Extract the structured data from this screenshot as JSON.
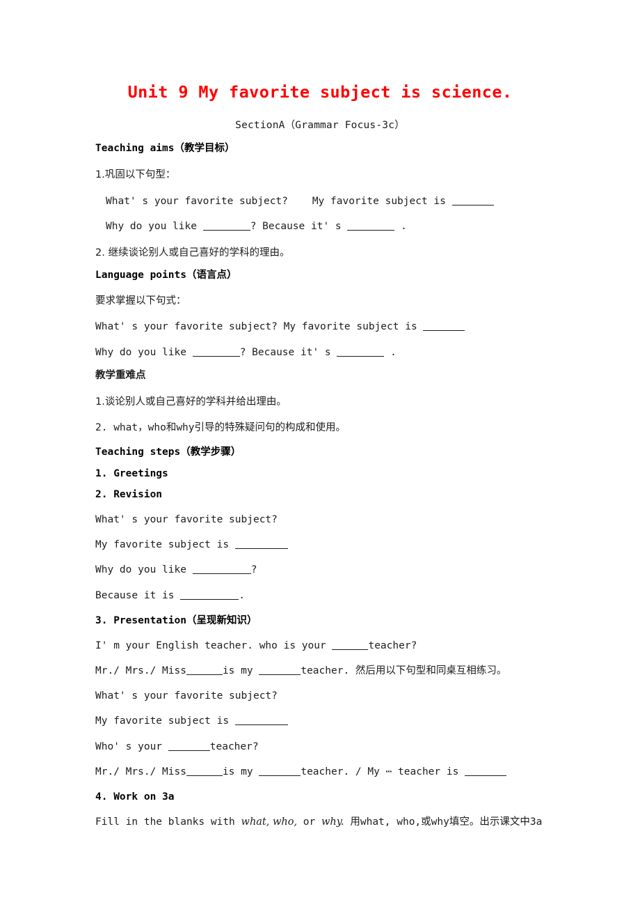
{
  "document": {
    "title": "Unit 9 My favorite subject is science.",
    "subtitle": "SectionA（Grammar Focus-3c）",
    "title_color": "#ff0000"
  },
  "sections": {
    "teaching_aims": {
      "heading": "Teaching aims（教学目标）",
      "item1": "1.巩固以下句型：",
      "q1_a": "What' s your favorite subject?",
      "q1_b": "My favorite subject is",
      "q2_a": "Why do you like",
      "q2_b": "?   Because it' s",
      "q2_c": ".",
      "item2": "2. 继续谈论别人或自己喜好的学科的理由。"
    },
    "language_points": {
      "heading": "Language points（语言点）",
      "intro": "要求掌握以下句式：",
      "line1": "What' s your favorite subject? My favorite subject is",
      "line2_a": "Why do you like",
      "line2_b": "?   Because it' s",
      "line2_c": "."
    },
    "key_difficulties": {
      "heading": "教学重难点",
      "item1": "1.谈论别人或自己喜好的学科并给出理由。",
      "item2_num": "2.",
      "item2_en1": "what，who",
      "item2_cn1": "和",
      "item2_en2": "why",
      "item2_cn2": "引导的特殊疑问句的构成和使用。"
    },
    "teaching_steps": {
      "heading": "Teaching steps（教学步骤）",
      "step1": "1. Greetings",
      "step2": "2. Revision",
      "revision_l1": "What' s your favorite subject?",
      "revision_l2": "My favorite subject is",
      "revision_l3_a": "Why do you like",
      "revision_l3_b": "?",
      "revision_l4_a": "Because it is",
      "revision_l4_b": ".",
      "step3": "3. Presentation（呈现新知识）",
      "pres_l1_a": "I' m your English teacher. who is your",
      "pres_l1_b": "teacher?",
      "pres_l2_a": "Mr./ Mrs./ Miss",
      "pres_l2_b": "is my",
      "pres_l2_c": "teacher.",
      "pres_l2_cn": "然后用以下句型和同桌互相练习。",
      "pres_l3": "What' s your favorite subject?",
      "pres_l4": "My favorite subject is",
      "pres_l5_a": "Who' s your",
      "pres_l5_b": "teacher?",
      "pres_l6_a": "Mr./ Mrs./ Miss",
      "pres_l6_b": "is my",
      "pres_l6_c": "teacher. / My ⋯ teacher is",
      "step4": "4. Work on 3a",
      "work3a_a": "Fill in the blanks with",
      "work3a_italic": "what, who,",
      "work3a_or": "or",
      "work3a_italic2": "why.",
      "work3a_cn1": "用",
      "work3a_en1": "what, who,",
      "work3a_cn2": "或",
      "work3a_en2": "why",
      "work3a_cn3": "填空。出示课文中",
      "work3a_en3": "3a"
    }
  }
}
